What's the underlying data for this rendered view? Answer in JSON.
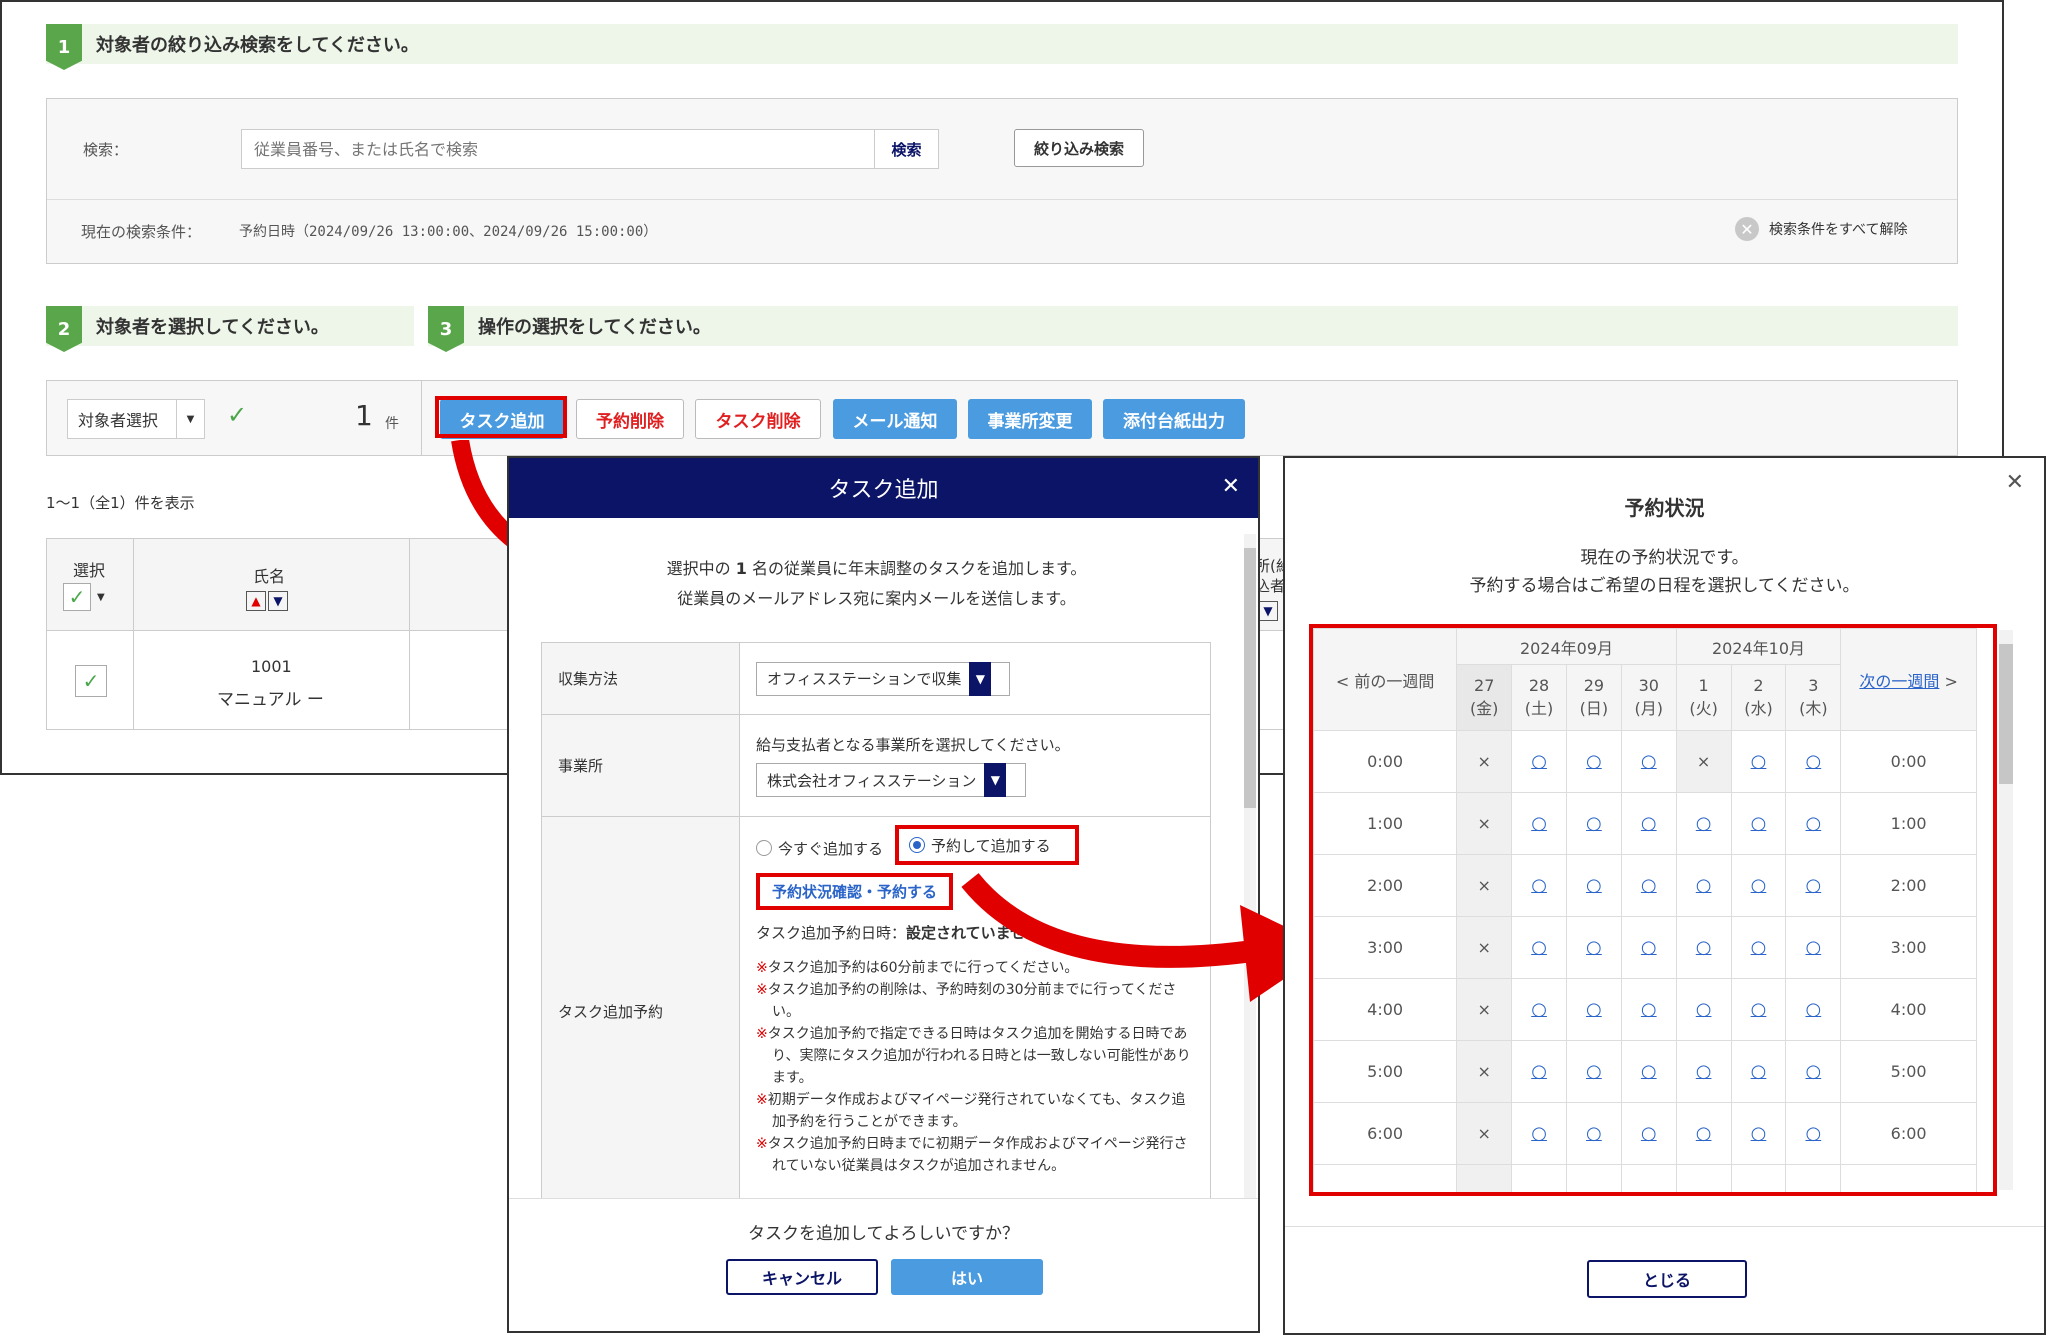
{
  "step1": {
    "num": "1",
    "title": "対象者の絞り込み検索をしてください。"
  },
  "search": {
    "label": "検索：",
    "placeholder": "従業員番号、または氏名で検索",
    "search_btn": "検索",
    "filter_btn": "絞り込み検索",
    "current_label": "現在の検索条件：",
    "current_value": "予約日時（2024/09/26 13:00:00、2024/09/26 15:00:00）",
    "clear_all": "検索条件をすべて解除"
  },
  "step2": {
    "num": "2",
    "title": "対象者を選択してください。"
  },
  "step3": {
    "num": "3",
    "title": "操作の選択をしてください。"
  },
  "selector": {
    "label": "対象者選択",
    "count": "1",
    "count_unit": "件"
  },
  "actions": {
    "task_add": "タスク追加",
    "reserve_delete": "予約削除",
    "task_delete": "タスク削除",
    "mail_notice": "メール通知",
    "office_change": "事業所変更",
    "attachment_output": "添付台紙出力"
  },
  "result_count": "1～1（全1）件を表示",
  "table": {
    "col_select": "選択",
    "col_name": "氏名",
    "col_partial": "所(約",
    "col_partial2": "込者",
    "row": {
      "id": "1001",
      "name": "マニュアル ー"
    }
  },
  "modal": {
    "title": "タスク追加",
    "intro_line1_pre": "選択中の",
    "intro_count": "1",
    "intro_line1_post": "名の従業員に年末調整のタスクを追加します。",
    "intro_line2": "従業員のメールアドレス宛に案内メールを送信します。",
    "collect_label": "収集方法",
    "collect_value": "オフィスステーションで収集",
    "office_label": "事業所",
    "office_hint": "給与支払者となる事業所を選択してください。",
    "office_value": "株式会社オフィスステーション",
    "reserve_label": "タスク追加予約",
    "radio_now": "今すぐ追加する",
    "radio_reserve": "予約して追加する",
    "reserve_link": "予約状況確認・予約する",
    "reserve_date_label": "タスク追加予約日時：",
    "reserve_date_value": "設定されていません",
    "notes": [
      "タスク追加予約は60分前までに行ってください。",
      "タスク追加予約の削除は、予約時刻の30分前までに行ってください。",
      "タスク追加予約で指定できる日時はタスク追加を開始する日時であり、実際にタスク追加が行われる日時とは一致しない可能性があります。",
      "初期データ作成およびマイページ発行されていなくても、タスク追加予約を行うことができます。",
      "タスク追加予約日時までに初期データ作成およびマイページ発行されていない従業員はタスクが追加されません。"
    ],
    "note_mark": "※",
    "confirm": "タスクを追加してよろしいですか？",
    "cancel_btn": "キャンセル",
    "yes_btn": "はい"
  },
  "status": {
    "title": "予約状況",
    "desc1": "現在の予約状況です。",
    "desc2": "予約する場合はご希望の日程を選択してください。",
    "prev_week": "< 前の一週間",
    "next_week": "次の一週間",
    "next_arrow": ">",
    "month1": "2024年09月",
    "month2": "2024年10月",
    "days": [
      {
        "d": "27",
        "w": "(金)"
      },
      {
        "d": "28",
        "w": "(土)"
      },
      {
        "d": "29",
        "w": "(日)"
      },
      {
        "d": "30",
        "w": "(月)"
      },
      {
        "d": "1",
        "w": "(火)"
      },
      {
        "d": "2",
        "w": "(水)"
      },
      {
        "d": "3",
        "w": "(木)"
      }
    ],
    "times": [
      "0:00",
      "1:00",
      "2:00",
      "3:00",
      "4:00",
      "5:00",
      "6:00"
    ],
    "mark_unavailable": "×",
    "mark_available": "○",
    "availability": [
      [
        false,
        true,
        true,
        true,
        false,
        true,
        true
      ],
      [
        false,
        true,
        true,
        true,
        true,
        true,
        true
      ],
      [
        false,
        true,
        true,
        true,
        true,
        true,
        true
      ],
      [
        false,
        true,
        true,
        true,
        true,
        true,
        true
      ],
      [
        false,
        true,
        true,
        true,
        true,
        true,
        true
      ],
      [
        false,
        true,
        true,
        true,
        true,
        true,
        true
      ],
      [
        false,
        true,
        true,
        true,
        true,
        true,
        true
      ]
    ],
    "close_btn": "とじる"
  },
  "colors": {
    "navy": "#0b1466",
    "green": "#5aa64b",
    "red": "#e00000",
    "blue": "#4a9be0"
  }
}
